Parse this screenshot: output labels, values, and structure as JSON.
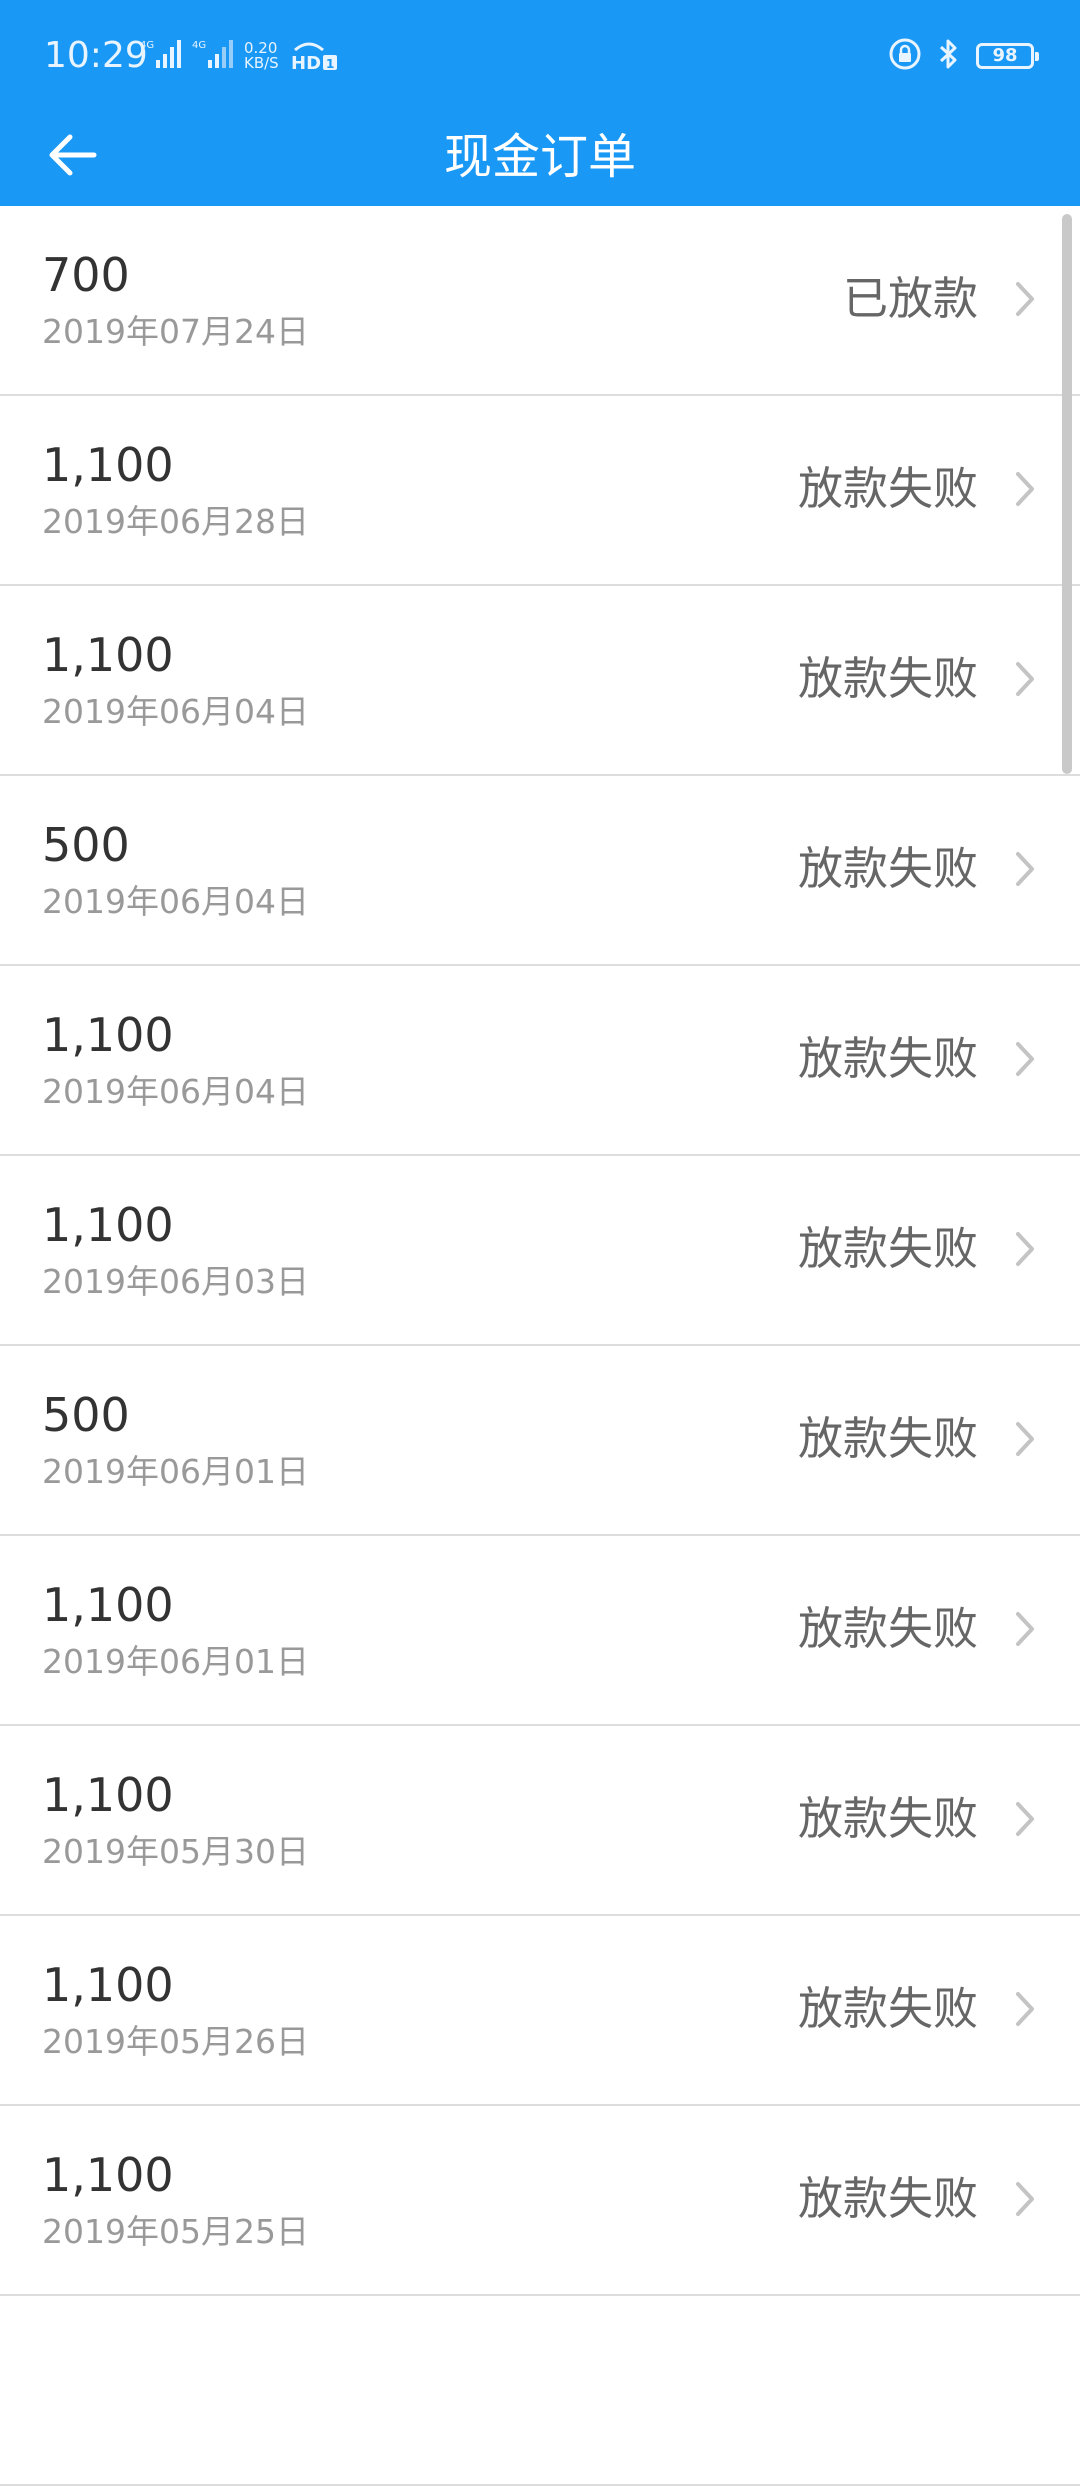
{
  "status_bar": {
    "time": "10:29",
    "signal_1": "4G",
    "signal_2": "4G",
    "net_speed_value": "0.20",
    "net_speed_unit": "KB/S",
    "hd_badge": "HD",
    "battery": "98",
    "icons": [
      "signal-icon",
      "hd-call-icon",
      "lock-icon",
      "bluetooth-icon",
      "battery-icon"
    ]
  },
  "header": {
    "title": "现金订单",
    "back_icon": "arrow-left-icon"
  },
  "colors": {
    "header_bg": "#1a98f5",
    "row_bg": "#ffffff",
    "divider": "#dddddd",
    "amount_text": "#333333",
    "secondary_text": "#999999",
    "status_text": "#666666"
  },
  "orders": [
    {
      "amount": "700",
      "date": "2019年07月24日",
      "status": "已放款"
    },
    {
      "amount": "1,100",
      "date": "2019年06月28日",
      "status": "放款失败"
    },
    {
      "amount": "1,100",
      "date": "2019年06月04日",
      "status": "放款失败"
    },
    {
      "amount": "500",
      "date": "2019年06月04日",
      "status": "放款失败"
    },
    {
      "amount": "1,100",
      "date": "2019年06月04日",
      "status": "放款失败"
    },
    {
      "amount": "1,100",
      "date": "2019年06月03日",
      "status": "放款失败"
    },
    {
      "amount": "500",
      "date": "2019年06月01日",
      "status": "放款失败"
    },
    {
      "amount": "1,100",
      "date": "2019年06月01日",
      "status": "放款失败"
    },
    {
      "amount": "1,100",
      "date": "2019年05月30日",
      "status": "放款失败"
    },
    {
      "amount": "1,100",
      "date": "2019年05月26日",
      "status": "放款失败"
    },
    {
      "amount": "1,100",
      "date": "2019年05月25日",
      "status": "放款失败"
    },
    {
      "amount": "",
      "date": "",
      "status": ""
    }
  ]
}
